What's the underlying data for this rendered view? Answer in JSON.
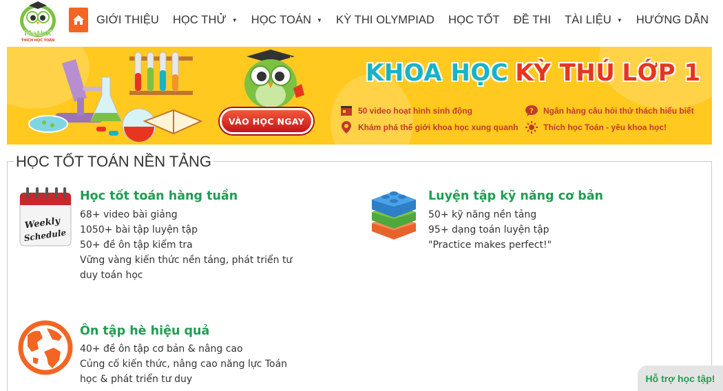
{
  "logo": {
    "brand": "MathX",
    "tagline": "THÍCH HỌC TOÁN"
  },
  "nav": {
    "home_icon": "home-icon",
    "items": [
      {
        "label": "GIỚI THIỆU",
        "dropdown": false
      },
      {
        "label": "HỌC THỬ",
        "dropdown": true
      },
      {
        "label": "HỌC TOÁN",
        "dropdown": true
      },
      {
        "label": "KỲ THI OLYMPIAD",
        "dropdown": false
      },
      {
        "label": "HỌC TỐT",
        "dropdown": false
      },
      {
        "label": "ĐỀ THI",
        "dropdown": false
      },
      {
        "label": "TÀI LIỆU",
        "dropdown": true
      },
      {
        "label": "HƯỚNG DẪN",
        "dropdown": false
      }
    ]
  },
  "banner": {
    "title_part1": "KHOA HỌC",
    "title_part2": "KỲ THÚ",
    "title_part3": "LỚP 1",
    "cta": "VÀO HỌC NGAY",
    "features": [
      {
        "icon": "film-icon",
        "text": "50 video hoạt hình sinh động"
      },
      {
        "icon": "chat-question-icon",
        "text": "Ngân hàng câu hỏi thử thách hiểu biết"
      },
      {
        "icon": "location-pin-icon",
        "text": "Khám phá thế giới khoa học xung quanh"
      },
      {
        "icon": "sun-icon",
        "text": "Thích học Toán - yêu khoa học!"
      }
    ],
    "colors": {
      "background": "#ffc920",
      "title_blue": "#18b3c4",
      "title_red": "#e8351f"
    }
  },
  "section": {
    "title": "HỌC TỐT TOÁN NỀN TẢNG",
    "cards": [
      {
        "icon": "weekly-schedule-calendar-icon",
        "icon_text_1": "Weekly",
        "icon_text_2": "Schedule",
        "title": "Học tốt toán hàng tuần",
        "lines": [
          "68+ video bài giảng",
          "1050+ bài tập luyện tập",
          "50+ đề ôn tập kiểm tra",
          "Vững vàng kiến thức nền tảng, phát triển tư",
          "duy toán học"
        ]
      },
      {
        "icon": "building-blocks-icon",
        "title": "Luyện tập kỹ năng cơ bản",
        "lines": [
          "50+ kỹ năng nền tảng",
          "95+ dạng toán luyện tập",
          "\"Practice makes perfect!\""
        ]
      },
      {
        "icon": "globe-icon",
        "title": "Ôn tập hè hiệu quả",
        "lines": [
          "40+ đề ôn tập cơ bản & nâng cao",
          "Củng cố kiến thức, nâng cao năng lực Toán",
          "học & phát triển tư duy"
        ]
      }
    ],
    "accent_color": "#1e9e52"
  },
  "help_button": {
    "label": "Hỗ trợ học tập!"
  }
}
